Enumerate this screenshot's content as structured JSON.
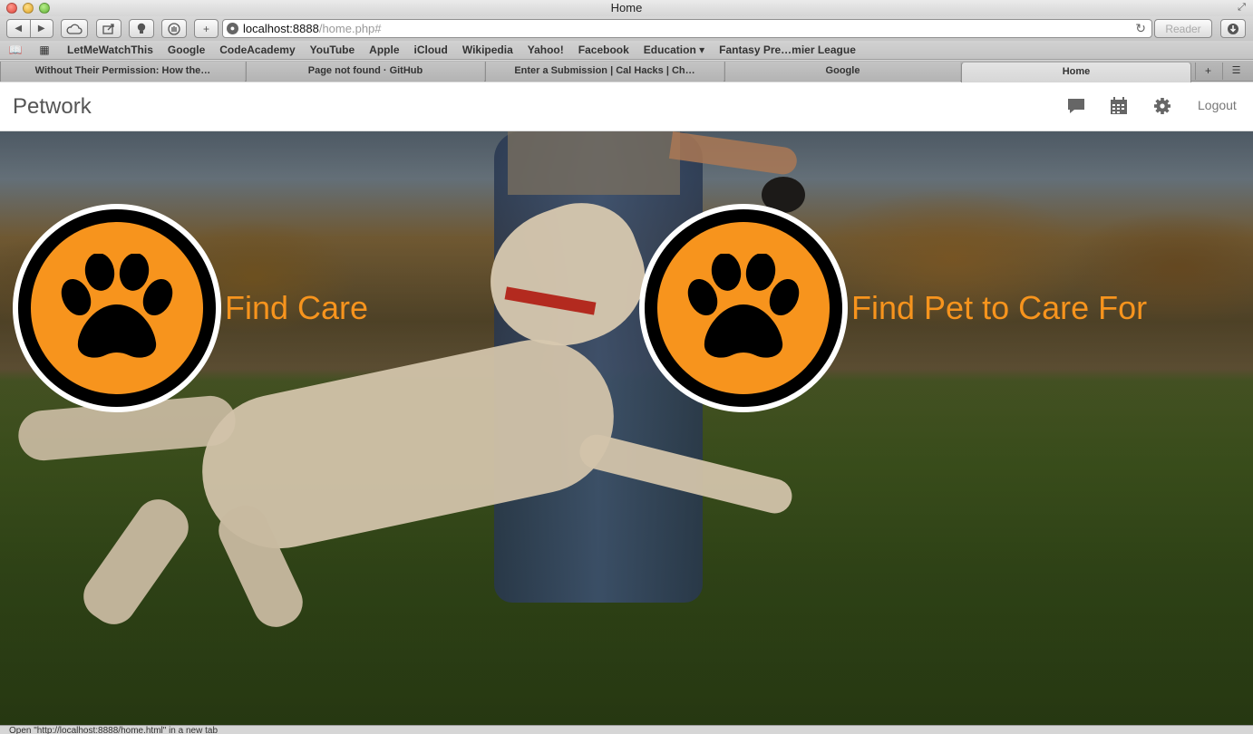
{
  "window": {
    "title": "Home"
  },
  "toolbar": {
    "url_host": "localhost:8888",
    "url_path": "/home.php#",
    "reader_label": "Reader"
  },
  "bookmarks": [
    "LetMeWatchThis",
    "Google",
    "CodeAcademy",
    "YouTube",
    "Apple",
    "iCloud",
    "Wikipedia",
    "Yahoo!",
    "Facebook",
    "Education ▾",
    "Fantasy Pre…mier League"
  ],
  "tabs": [
    {
      "label": "Without Their Permission: How the…",
      "active": false
    },
    {
      "label": "Page not found · GitHub",
      "active": false
    },
    {
      "label": "Enter a Submission | Cal Hacks | Ch…",
      "active": false
    },
    {
      "label": "Google",
      "active": false
    },
    {
      "label": "Home",
      "active": true
    }
  ],
  "navbar": {
    "brand": "Petwork",
    "icons": [
      "chat-icon",
      "calendar-icon",
      "gear-icon"
    ],
    "logout_label": "Logout"
  },
  "hero": {
    "find_care_label": "Find Care",
    "find_pet_label": "Find Pet to Care For",
    "accent_color": "#f7941d"
  },
  "status": {
    "text": "Open \"http://localhost:8888/home.html\" in a new tab"
  }
}
